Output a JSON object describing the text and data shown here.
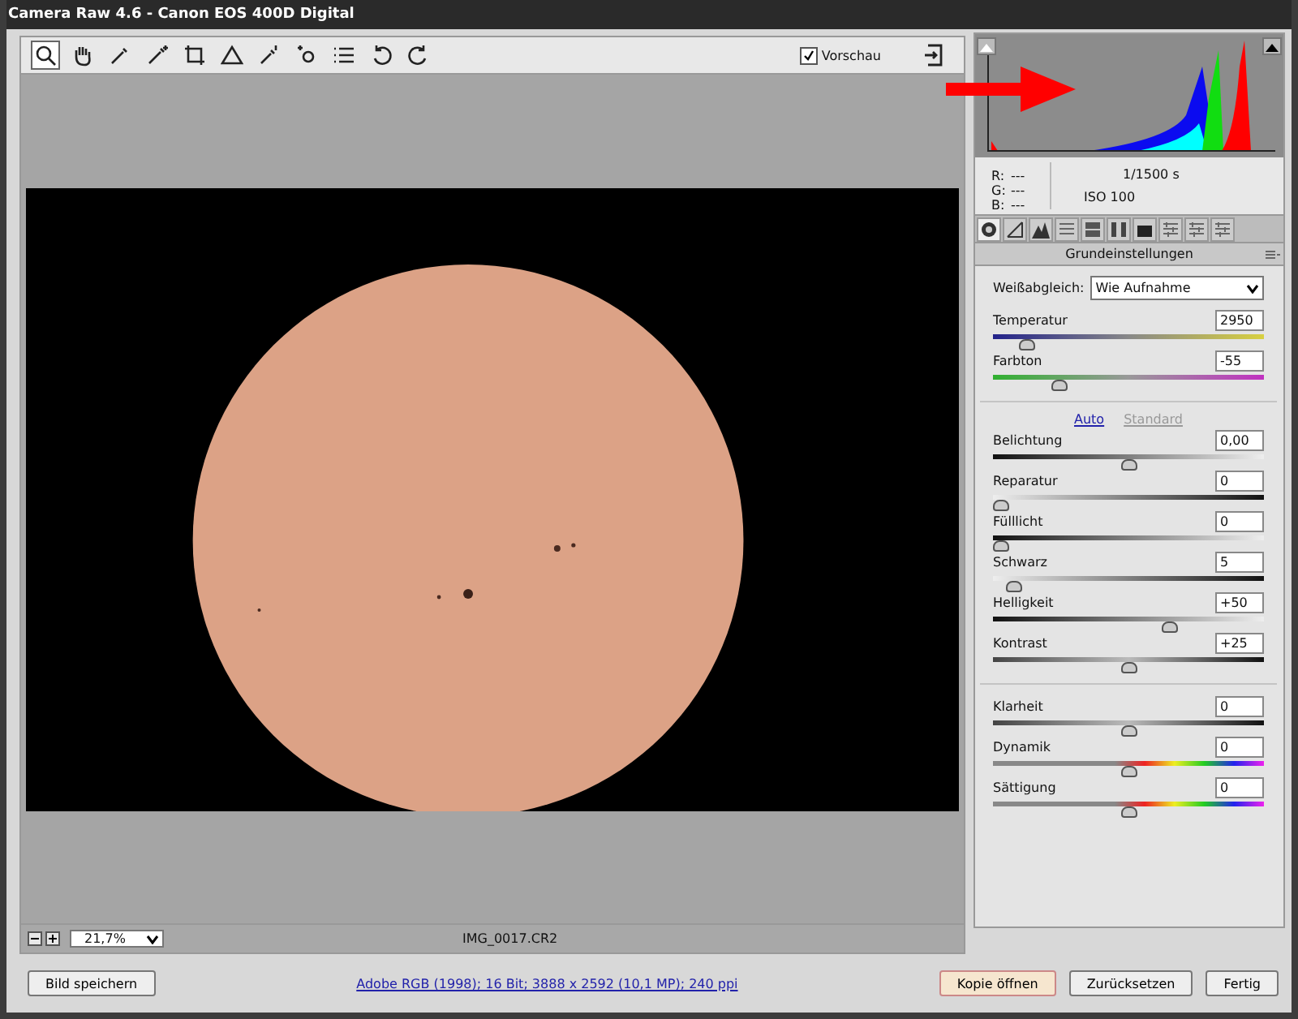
{
  "window": {
    "title": "Camera Raw 4.6 - Canon EOS 400D Digital"
  },
  "toolbar": {
    "tools": [
      {
        "selected": true
      },
      {
        "selected": false
      },
      {
        "selected": false
      },
      {
        "selected": false
      },
      {
        "selected": false
      },
      {
        "selected": false
      },
      {
        "selected": false
      },
      {
        "selected": false
      },
      {
        "selected": false
      },
      {
        "selected": false
      },
      {
        "selected": false
      }
    ],
    "preview": {
      "label": "Vorschau",
      "checked": true
    }
  },
  "preview_bar": {
    "zoom": "21,7%",
    "filename": "IMG_0017.CR2"
  },
  "info": {
    "r_label": "R:",
    "r": "---",
    "g_label": "G:",
    "g": "---",
    "b_label": "B:",
    "b": "---",
    "shutter": "1/1500 s",
    "iso": "ISO 100"
  },
  "panel_tabs": [
    {
      "selected": true
    },
    {
      "selected": false
    },
    {
      "selected": false
    },
    {
      "selected": false
    },
    {
      "selected": false
    },
    {
      "selected": false
    },
    {
      "selected": false
    },
    {
      "selected": false
    },
    {
      "selected": false
    },
    {
      "selected": false
    }
  ],
  "panel_title": "Grundeinstellungen",
  "white_balance": {
    "label": "Weißabgleich:",
    "value": "Wie Aufnahme"
  },
  "links": [
    {
      "label": "Auto",
      "enabled": true
    },
    {
      "label": "Standard",
      "enabled": false
    }
  ],
  "sections": [
    {
      "sliders": [
        {
          "name": "Temperatur",
          "value": "2950",
          "level": 0.1,
          "kind": "temperature"
        },
        {
          "name": "Farbton",
          "value": "-55",
          "level": 0.23,
          "kind": "tint"
        }
      ]
    },
    {
      "sliders": [
        {
          "name": "Belichtung",
          "value": "0,00",
          "level": 0.5,
          "kind": "rising"
        },
        {
          "name": "Reparatur",
          "value": "0",
          "level": 0.0,
          "kind": "falling"
        },
        {
          "name": "Fülllicht",
          "value": "0",
          "level": 0.0,
          "kind": "rising"
        },
        {
          "name": "Schwarz",
          "value": "5",
          "level": 0.05,
          "kind": "falling"
        },
        {
          "name": "Helligkeit",
          "value": "+50",
          "level": 0.66,
          "kind": "rising"
        },
        {
          "name": "Kontrast",
          "value": "+25",
          "level": 0.5,
          "kind": "contrast"
        }
      ]
    },
    {
      "sliders": [
        {
          "name": "Klarheit",
          "value": "0",
          "level": 0.5,
          "kind": "contrast"
        },
        {
          "name": "Dynamik",
          "value": "0",
          "level": 0.5,
          "kind": "saturation"
        },
        {
          "name": "Sättigung",
          "value": "0",
          "level": 0.5,
          "kind": "saturation"
        }
      ]
    }
  ],
  "footer": {
    "save": "Bild speichern",
    "workflow_link": "Adobe RGB (1998); 16 Bit; 3888 x 2592 (10,1 MP); 240 ppi",
    "buttons": [
      {
        "label": "Kopie öffnen",
        "default": true
      },
      {
        "label": "Zurücksetzen",
        "default": false
      },
      {
        "label": "Fertig",
        "default": false
      }
    ]
  }
}
